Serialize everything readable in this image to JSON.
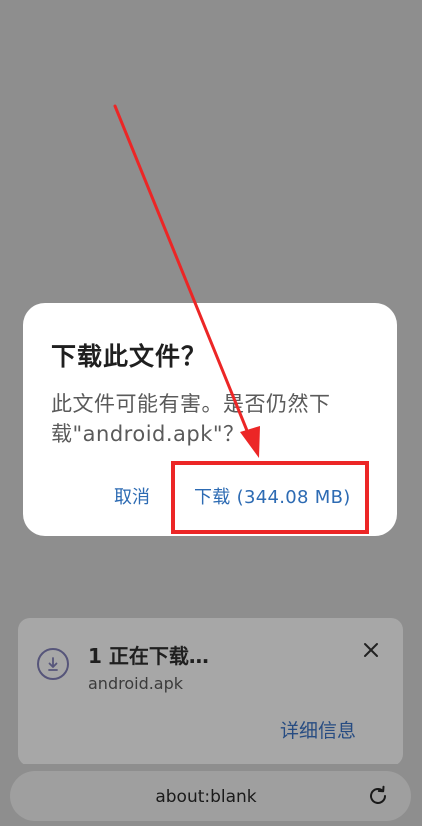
{
  "dialog": {
    "title": "下载此文件？",
    "message": "此文件可能有害。是否仍然下载\"android.apk\"？",
    "cancel_label": "取消",
    "download_label": "下载 (344.08 MB)"
  },
  "download_notification": {
    "title": "1 正在下载…",
    "filename": "android.apk",
    "details_label": "详细信息",
    "icon": "download-icon",
    "close_icon": "close-icon"
  },
  "address_bar": {
    "url": "about:blank",
    "reload_icon": "reload-icon"
  },
  "colors": {
    "dim_background": "#8e8e8e",
    "dialog_bg": "#ffffff",
    "accent_link": "#2d6bb3",
    "annotation_red": "#ec2626"
  }
}
